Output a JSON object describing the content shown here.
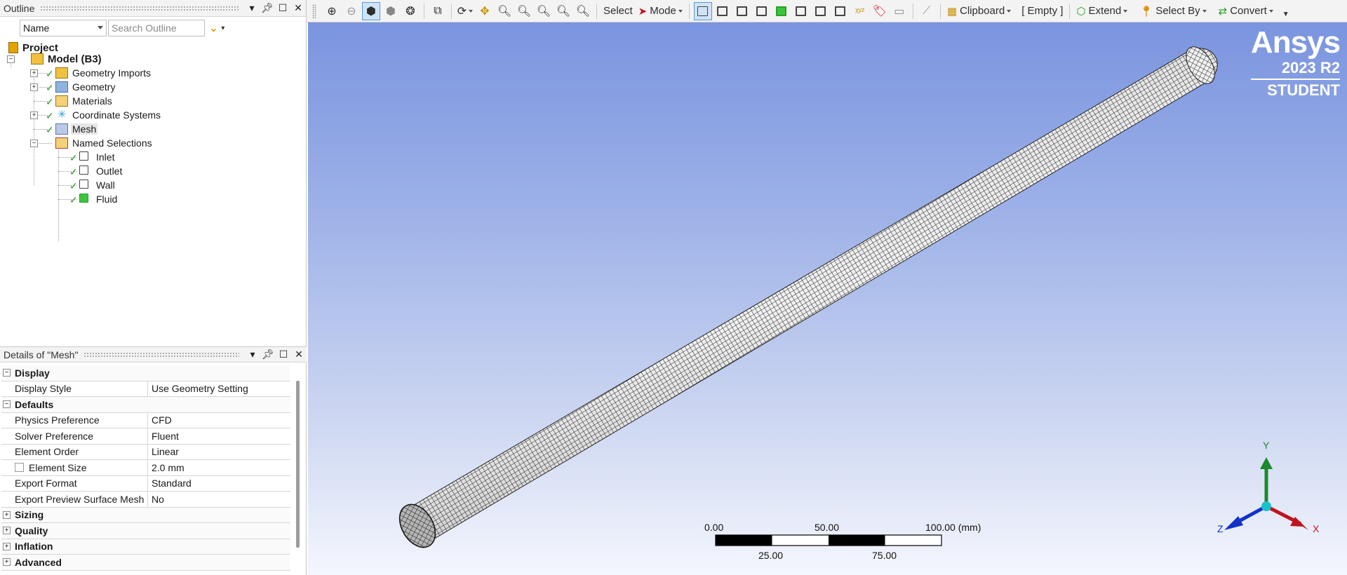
{
  "outline": {
    "title": "Outline",
    "name_filter": "Name",
    "search_placeholder": "Search Outline",
    "tree": {
      "project": "Project",
      "model": "Model (B3)",
      "geometry_imports": "Geometry Imports",
      "geometry": "Geometry",
      "materials": "Materials",
      "coordinate_systems": "Coordinate Systems",
      "mesh": "Mesh",
      "named_selections": "Named Selections",
      "inlet": "Inlet",
      "outlet": "Outlet",
      "wall": "Wall",
      "fluid": "Fluid"
    }
  },
  "details": {
    "title": "Details of \"Mesh\"",
    "rows": [
      {
        "type": "cat",
        "label": "Display",
        "expand": "−"
      },
      {
        "type": "prop",
        "label": "Display Style",
        "value": "Use Geometry Setting"
      },
      {
        "type": "cat",
        "label": "Defaults",
        "expand": "−"
      },
      {
        "type": "prop",
        "label": "Physics Preference",
        "value": "CFD"
      },
      {
        "type": "prop",
        "label": "Solver Preference",
        "value": "Fluent"
      },
      {
        "type": "prop",
        "label": "Element Order",
        "value": "Linear"
      },
      {
        "type": "prop",
        "label": "Element Size",
        "value": "2.0 mm",
        "checkbox": true
      },
      {
        "type": "prop",
        "label": "Export Format",
        "value": "Standard"
      },
      {
        "type": "prop",
        "label": "Export Preview Surface Mesh",
        "value": "No"
      },
      {
        "type": "cat",
        "label": "Sizing",
        "expand": "+"
      },
      {
        "type": "cat",
        "label": "Quality",
        "expand": "+"
      },
      {
        "type": "cat",
        "label": "Inflation",
        "expand": "+"
      },
      {
        "type": "cat",
        "label": "Advanced",
        "expand": "+"
      }
    ]
  },
  "toolbar": {
    "select": "Select",
    "mode": "Mode",
    "clipboard": "Clipboard",
    "empty": "[ Empty ]",
    "extend": "Extend",
    "select_by": "Select By",
    "convert": "Convert"
  },
  "viewport": {
    "brand": "Ansys",
    "version": "2023 R2",
    "edition": "STUDENT",
    "scale": {
      "top_labels": [
        "0.00",
        "50.00",
        "100.00 (mm)"
      ],
      "bottom_labels": [
        "25.00",
        "75.00"
      ]
    },
    "triad": {
      "x": "X",
      "y": "Y",
      "z": "Z"
    },
    "colors": {
      "x_axis": "#c0141c",
      "y_axis": "#1a8a2a",
      "z_axis": "#1432c8",
      "origin": "#19c2c8"
    }
  }
}
